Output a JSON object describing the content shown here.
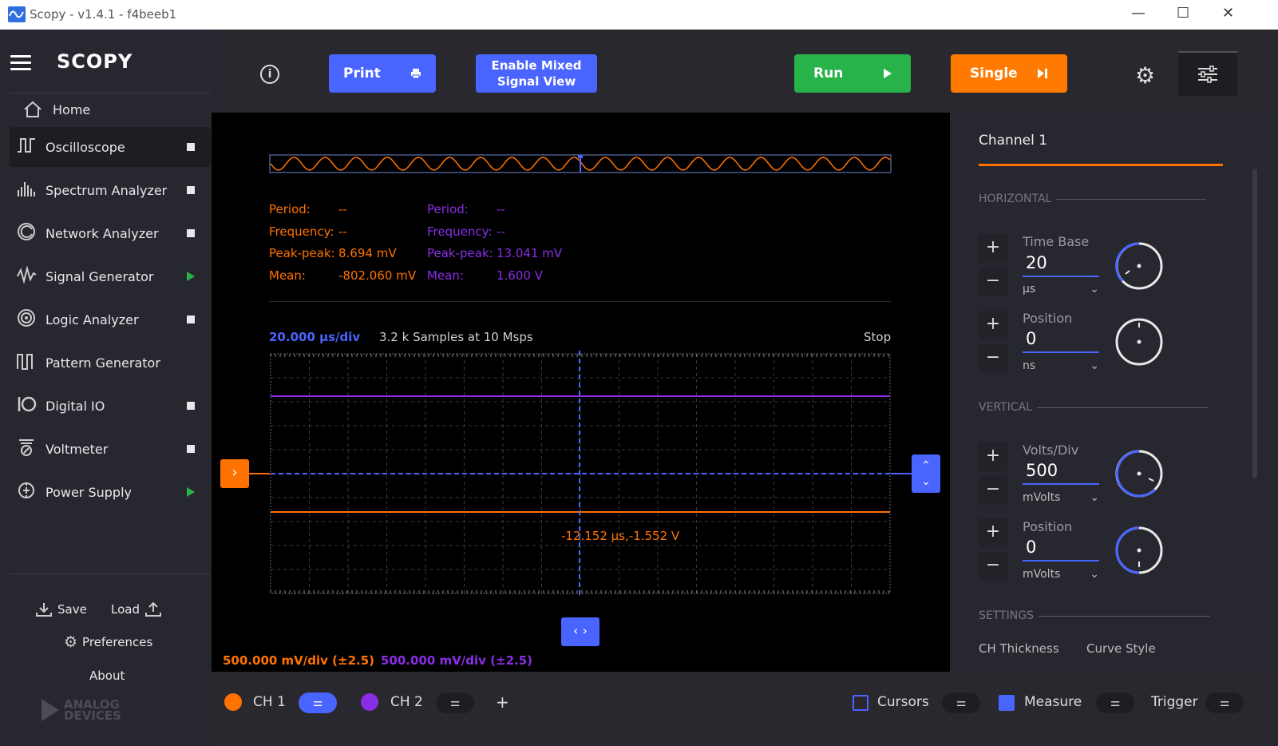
{
  "window": {
    "title": "Scopy - v1.4.1 - f4beeb1",
    "minimize": "—",
    "maximize": "☐",
    "close": "✕"
  },
  "sidebar": {
    "logo": "SCOPY",
    "home": "Home",
    "items": [
      {
        "label": "Oscilloscope",
        "icon": "oscilloscope-icon",
        "indicator": "stop"
      },
      {
        "label": "Spectrum Analyzer",
        "icon": "spectrum-icon",
        "indicator": "stop"
      },
      {
        "label": "Network Analyzer",
        "icon": "network-icon",
        "indicator": "stop"
      },
      {
        "label": "Signal Generator",
        "icon": "signal-generator-icon",
        "indicator": "play"
      },
      {
        "label": "Logic Analyzer",
        "icon": "logic-icon",
        "indicator": "stop"
      },
      {
        "label": "Pattern Generator",
        "icon": "pattern-icon",
        "indicator": "none"
      },
      {
        "label": "Digital IO",
        "icon": "digital-io-icon",
        "indicator": "stop"
      },
      {
        "label": "Voltmeter",
        "icon": "voltmeter-icon",
        "indicator": "stop"
      },
      {
        "label": "Power Supply",
        "icon": "power-supply-icon",
        "indicator": "play"
      }
    ],
    "save": "Save",
    "load": "Load",
    "preferences": "Preferences",
    "about": "About",
    "brand_line1": "ANALOG",
    "brand_line2": "DEVICES"
  },
  "toolbar": {
    "print": "Print",
    "mixed_line1": "Enable Mixed",
    "mixed_line2": "Signal View",
    "run": "Run",
    "single": "Single"
  },
  "measurements": {
    "ch1": {
      "period_label": "Period:",
      "period": "--",
      "freq_label": "Frequency:",
      "freq": "--",
      "pp_label": "Peak-peak:",
      "pp": "8.694 mV",
      "mean_label": "Mean:",
      "mean": "-802.060 mV"
    },
    "ch2": {
      "period_label": "Period:",
      "period": "--",
      "freq_label": "Frequency:",
      "freq": "--",
      "pp_label": "Peak-peak:",
      "pp": "13.041 mV",
      "mean_label": "Mean:",
      "mean": "1.600 V"
    }
  },
  "plot": {
    "timebase": "20.000 µs/div",
    "samples": "3.2 k Samples at 10 Msps",
    "status": "Stop",
    "cursor_readout": "-12.152 µs,-1.552 V",
    "ch1_scale": "500.000 mV/div (±2.5)",
    "ch2_scale": "500.000 mV/div (±2.5)"
  },
  "channel_panel": {
    "title": "Channel 1",
    "horizontal": "HORIZONTAL",
    "time_base_label": "Time Base",
    "time_base_value": "20",
    "time_base_unit": "µs",
    "h_position_label": "Position",
    "h_position_value": "0",
    "h_position_unit": "ns",
    "vertical": "VERTICAL",
    "volts_div_label": "Volts/Div",
    "volts_div_value": "500",
    "volts_div_unit": "mVolts",
    "v_position_label": "Position",
    "v_position_value": "0",
    "v_position_unit": "mVolts",
    "settings": "SETTINGS",
    "ch_thickness": "CH Thickness",
    "curve_style": "Curve Style"
  },
  "bottom": {
    "ch1": "CH 1",
    "ch2": "CH 2",
    "add": "+",
    "cursors": "Cursors",
    "measure": "Measure",
    "trigger": "Trigger"
  },
  "colors": {
    "ch1": "#ff7200",
    "ch2": "#8a2ee6",
    "accent": "#4a64ff",
    "run": "#27b34a",
    "single": "#ff7a00"
  }
}
